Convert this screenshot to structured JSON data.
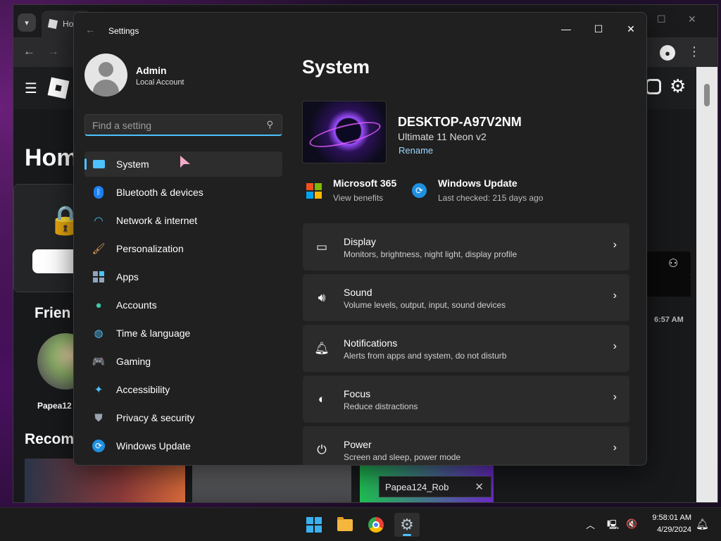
{
  "browser": {
    "tab_title": "Ho",
    "roblox": {
      "home_heading": "Hom",
      "friends_heading": "Frien",
      "friend_name": "Papea12",
      "recommended_heading": "Recom",
      "chat_time": "6:57 AM"
    },
    "toast": {
      "label": "Papea124_Rob"
    }
  },
  "settings": {
    "window_title": "Settings",
    "user": {
      "name": "Admin",
      "account_type": "Local Account"
    },
    "search": {
      "placeholder": "Find a setting"
    },
    "nav": [
      {
        "label": "System",
        "icon": "system-icon",
        "active": true
      },
      {
        "label": "Bluetooth & devices",
        "icon": "bluetooth-icon"
      },
      {
        "label": "Network & internet",
        "icon": "wifi-icon"
      },
      {
        "label": "Personalization",
        "icon": "brush-icon"
      },
      {
        "label": "Apps",
        "icon": "apps-icon"
      },
      {
        "label": "Accounts",
        "icon": "accounts-icon"
      },
      {
        "label": "Time & language",
        "icon": "globe-clock-icon"
      },
      {
        "label": "Gaming",
        "icon": "gamepad-icon"
      },
      {
        "label": "Accessibility",
        "icon": "accessibility-icon"
      },
      {
        "label": "Privacy & security",
        "icon": "shield-icon"
      },
      {
        "label": "Windows Update",
        "icon": "update-icon"
      }
    ],
    "page_title": "System",
    "device": {
      "name": "DESKTOP-A97V2NM",
      "model": "Ultimate 11 Neon v2",
      "rename_link": "Rename"
    },
    "quick_links": [
      {
        "title": "Microsoft 365",
        "subtitle": "View benefits",
        "icon": "microsoft-icon"
      },
      {
        "title": "Windows Update",
        "subtitle": "Last checked: 215 days ago",
        "icon": "update-icon"
      }
    ],
    "cards": [
      {
        "title": "Display",
        "subtitle": "Monitors, brightness, night light, display profile",
        "icon": "monitor-icon"
      },
      {
        "title": "Sound",
        "subtitle": "Volume levels, output, input, sound devices",
        "icon": "speaker-icon"
      },
      {
        "title": "Notifications",
        "subtitle": "Alerts from apps and system, do not disturb",
        "icon": "bell-icon"
      },
      {
        "title": "Focus",
        "subtitle": "Reduce distractions",
        "icon": "focus-icon"
      },
      {
        "title": "Power",
        "subtitle": "Screen and sleep, power mode",
        "icon": "power-icon"
      }
    ]
  },
  "taskbar": {
    "time": "9:58:01 AM",
    "date": "4/29/2024",
    "apps": [
      "start-icon",
      "file-explorer-icon",
      "chrome-icon",
      "settings-icon"
    ]
  },
  "colors": {
    "accent": "#4cc2ff",
    "window_bg": "#202020",
    "card_bg": "#2b2b2b",
    "link": "#9cd8ff"
  }
}
